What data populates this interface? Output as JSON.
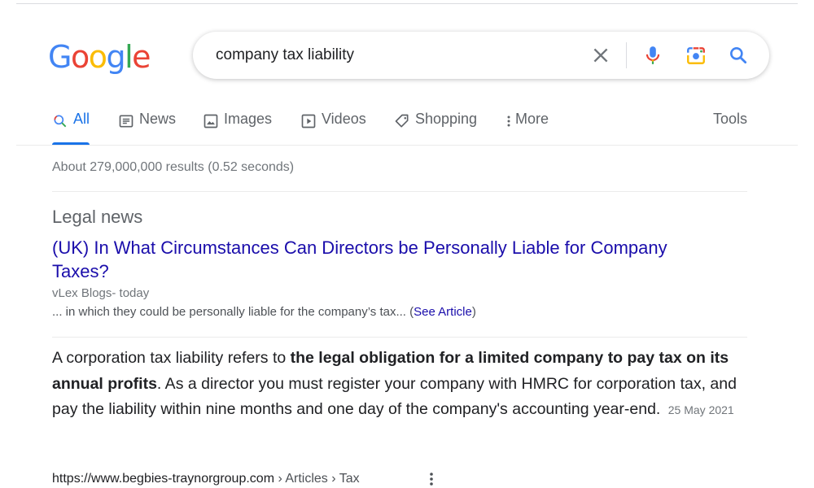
{
  "logo": {
    "letters": [
      "G",
      "o",
      "o",
      "g",
      "l",
      "e"
    ],
    "colors": [
      "#4285F4",
      "#EA4335",
      "#FBBC05",
      "#4285F4",
      "#34A853",
      "#EA4335"
    ]
  },
  "search": {
    "query": "company tax liability",
    "icons": [
      "close-icon",
      "microphone-icon",
      "camera-lens-icon",
      "search-icon"
    ]
  },
  "tabs": [
    {
      "label": "All",
      "icon": "search-icon",
      "active": true
    },
    {
      "label": "News",
      "icon": "news-icon"
    },
    {
      "label": "Images",
      "icon": "image-icon"
    },
    {
      "label": "Videos",
      "icon": "video-icon"
    },
    {
      "label": "Shopping",
      "icon": "tag-icon"
    },
    {
      "label": "More",
      "icon": "more-vert-icon"
    }
  ],
  "tools_label": "Tools",
  "stats": "About 279,000,000 results (0.52 seconds)",
  "legal_news": {
    "heading": "Legal news",
    "title": "(UK) In What Circumstances Can Directors be Personally Liable for Company Taxes?",
    "source": "vLex Blogs- today",
    "snippet_before": "... in which they could be personally liable for the company’s tax... (",
    "snippet_link": "See Article",
    "snippet_after": ")"
  },
  "featured_snippet": {
    "text_start": "A corporation tax liability refers to ",
    "text_bold": "the legal obligation for a limited company to pay tax on its annual profits",
    "text_end": ". As a director you must register your company with HMRC for corporation tax, and pay the liability within nine months and one day of the company's accounting year-end.",
    "date": "25 May 2021"
  },
  "result": {
    "url_domain": "https://www.begbies-traynorgroup.com",
    "breadcrumb": " › Articles › Tax"
  },
  "colors": {
    "link": "#1a0dab",
    "accent": "#1a73e8",
    "muted": "#70757a"
  }
}
